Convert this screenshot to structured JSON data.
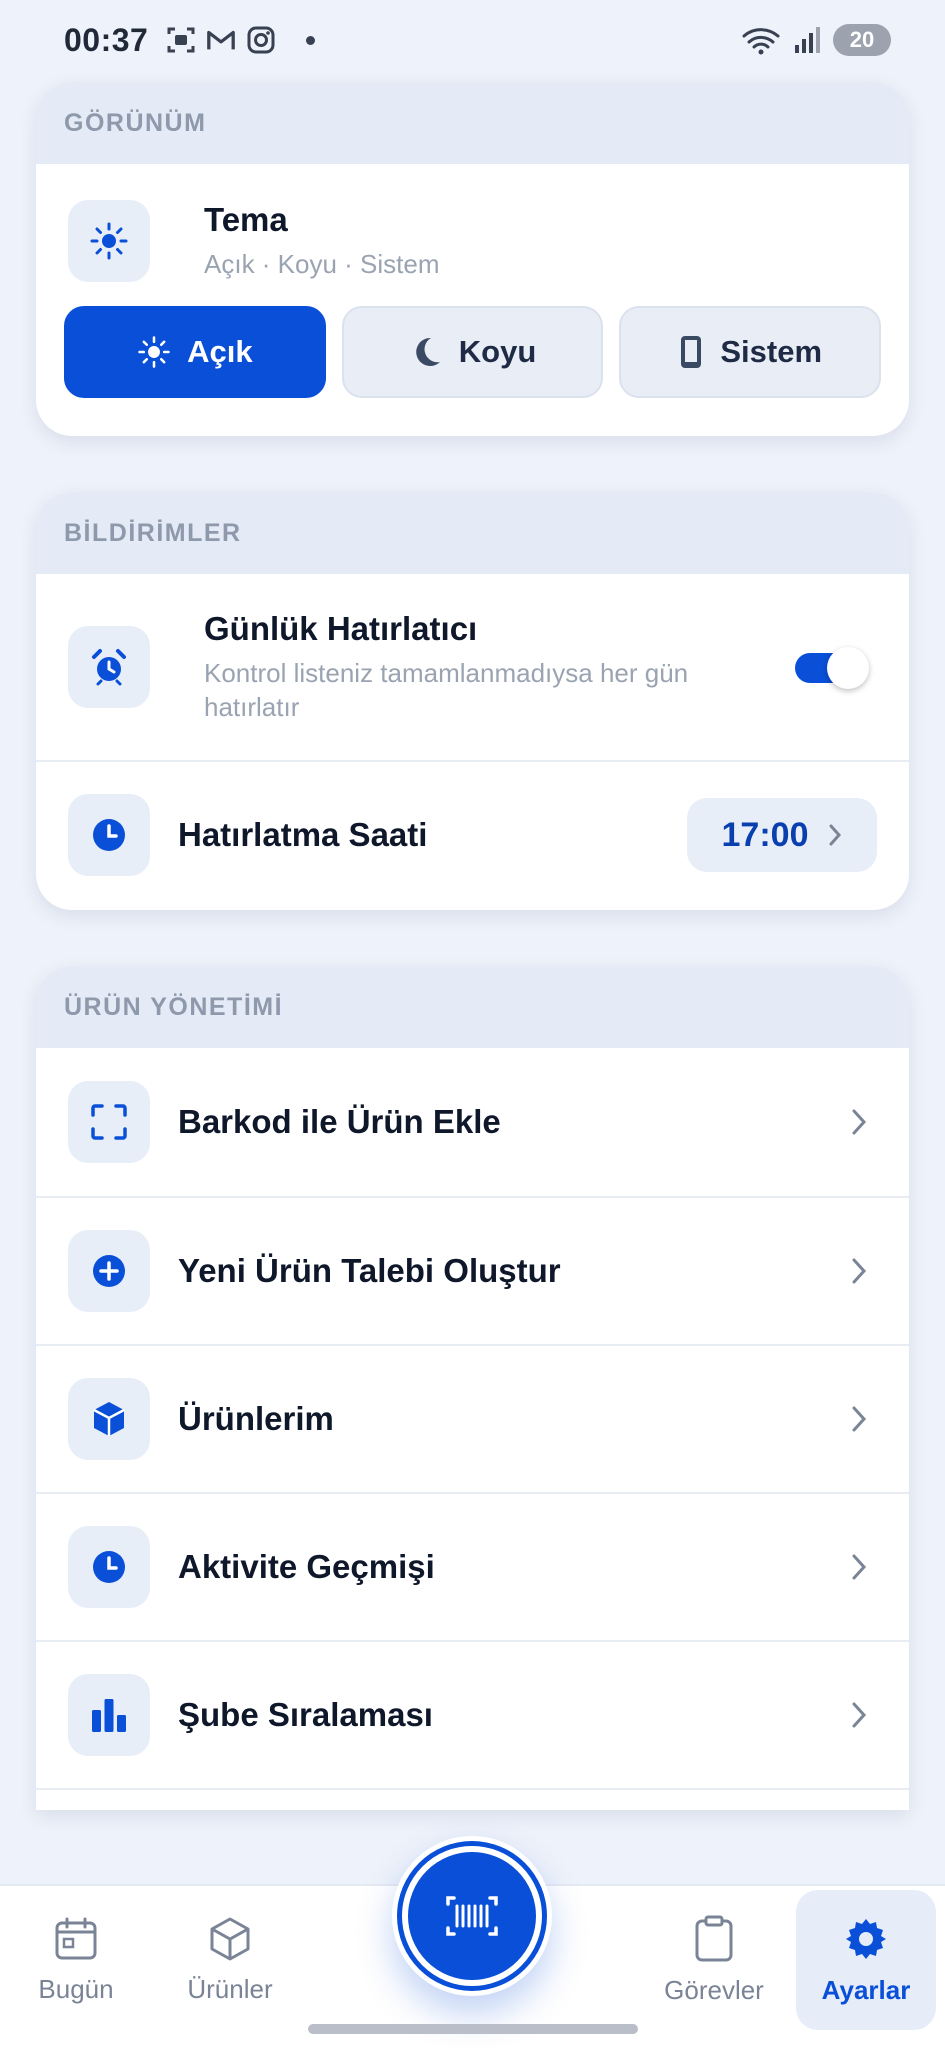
{
  "status_bar": {
    "time": "00:37",
    "battery": "20"
  },
  "appearance": {
    "header": "GÖRÜNÜM",
    "theme_title": "Tema",
    "theme_sub": "Açık · Koyu · Sistem",
    "buttons": [
      {
        "label": "Açık",
        "icon": "sun-icon",
        "active": true
      },
      {
        "label": "Koyu",
        "icon": "moon-icon",
        "active": false
      },
      {
        "label": "Sistem",
        "icon": "phone-icon",
        "active": false
      }
    ]
  },
  "notifications": {
    "header": "BİLDİRİMLER",
    "reminder_title": "Günlük Hatırlatıcı",
    "reminder_sub": "Kontrol listeniz tamamlanmadıysa her gün hatırlatır",
    "reminder_enabled": true,
    "time_title": "Hatırlatma Saati",
    "time_value": "17:00"
  },
  "product_management": {
    "header": "ÜRÜN YÖNETİMİ",
    "items": [
      {
        "label": "Barkod ile Ürün Ekle",
        "icon": "scan-frame-icon"
      },
      {
        "label": "Yeni Ürün Talebi Oluştur",
        "icon": "plus-circle-icon"
      },
      {
        "label": "Ürünlerim",
        "icon": "cube-icon"
      },
      {
        "label": "Aktivite Geçmişi",
        "icon": "clock-icon"
      },
      {
        "label": "Şube Sıralaması",
        "icon": "bar-chart-icon"
      }
    ]
  },
  "bottom_nav": {
    "items": [
      {
        "label": "Bugün",
        "icon": "calendar-icon"
      },
      {
        "label": "Ürünler",
        "icon": "box-icon"
      },
      {
        "label": "Görevler",
        "icon": "clipboard-icon"
      },
      {
        "label": "Ayarlar",
        "icon": "gear-icon",
        "active": true
      }
    ],
    "fab_icon": "barcode-icon"
  },
  "colors": {
    "accent": "#0a4fd8",
    "background": "#eef2fa",
    "header_bg": "#e4eaf6"
  }
}
